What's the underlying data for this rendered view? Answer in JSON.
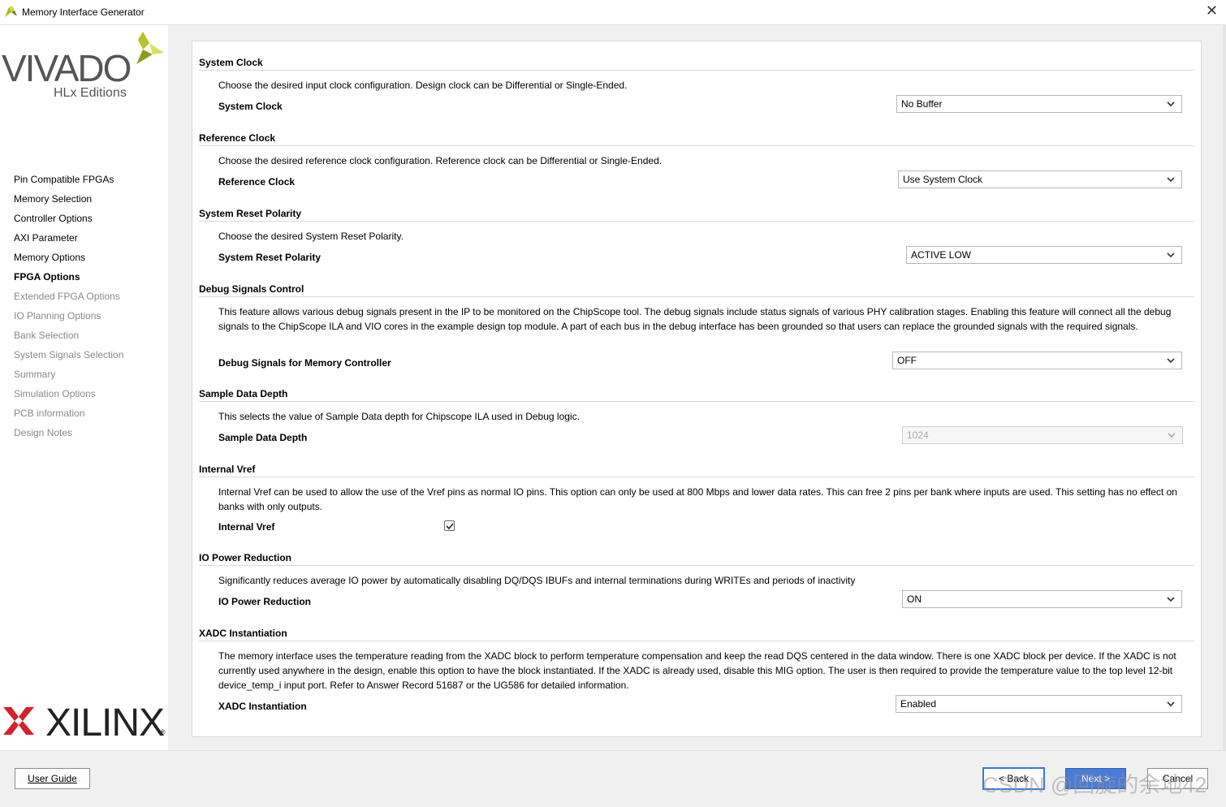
{
  "window": {
    "title": "Memory Interface Generator",
    "close_glyph": "✕"
  },
  "branding": {
    "vivado": "VIVADO",
    "hlx": "HLx Editions",
    "xilinx": "XILINX",
    "registered": "®"
  },
  "nav": [
    {
      "label": "Pin Compatible FPGAs",
      "state": "done"
    },
    {
      "label": "Memory Selection",
      "state": "done"
    },
    {
      "label": "Controller Options",
      "state": "done"
    },
    {
      "label": "AXI Parameter",
      "state": "done"
    },
    {
      "label": "Memory Options",
      "state": "done"
    },
    {
      "label": "FPGA Options",
      "state": "current"
    },
    {
      "label": "Extended FPGA Options",
      "state": "todo"
    },
    {
      "label": "IO Planning Options",
      "state": "todo"
    },
    {
      "label": "Bank Selection",
      "state": "todo"
    },
    {
      "label": "System Signals Selection",
      "state": "todo"
    },
    {
      "label": "Summary",
      "state": "todo"
    },
    {
      "label": "Simulation Options",
      "state": "todo"
    },
    {
      "label": "PCB information",
      "state": "todo"
    },
    {
      "label": "Design Notes",
      "state": "todo"
    }
  ],
  "sections": {
    "system_clock": {
      "title": "System Clock",
      "description": "Choose the desired input clock configuration. Design clock can be Differential or Single-Ended.",
      "label": "System Clock",
      "value": "No Buffer"
    },
    "reference_clock": {
      "title": "Reference Clock",
      "description": "Choose the desired reference clock configuration. Reference clock can be Differential or Single-Ended.",
      "label": "Reference Clock",
      "value": "Use System Clock"
    },
    "reset_polarity": {
      "title": "System Reset Polarity",
      "description": "Choose the desired System Reset Polarity.",
      "label": "System Reset Polarity",
      "value": "ACTIVE LOW"
    },
    "debug": {
      "title": "Debug Signals Control",
      "description": "This feature allows various debug signals present in the IP to be monitored on the ChipScope tool. The debug signals include status signals of various PHY calibration stages. Enabling this feature will connect all the debug signals to the ChipScope ILA and VIO cores in the example design top module. A part of each bus in the debug interface has been grounded so that users can replace the grounded signals with the required signals.",
      "label": "Debug Signals for Memory Controller",
      "value": "OFF"
    },
    "sample_depth": {
      "title": "Sample Data Depth",
      "description": "This selects the value of Sample Data depth for Chipscope ILA used in Debug logic.",
      "label": "Sample Data Depth",
      "value": "1024"
    },
    "internal_vref": {
      "title": "Internal Vref",
      "description": "Internal Vref can be used to allow the use of the Vref pins as normal IO pins. This option can only be used at 800 Mbps and lower data rates. This can free 2 pins per bank where inputs are used. This setting has no effect on banks with only outputs.",
      "label": "Internal Vref",
      "checked": true
    },
    "io_power": {
      "title": "IO Power Reduction",
      "description": "Significantly reduces average IO power by automatically disabling DQ/DQS IBUFs and internal terminations during WRITEs and periods of inactivity",
      "label": "IO Power Reduction",
      "value": "ON"
    },
    "xadc": {
      "title": "XADC Instantiation",
      "description": "The memory interface uses the temperature reading from the XADC block to perform temperature compensation and keep the read DQS centered in the data window. There is one XADC block per device. If the XADC is not currently used anywhere in the design, enable this option to have the block instantiated. If the XADC is already used, disable this MIG option. The user is then required to provide the temperature value to the top level 12-bit device_temp_i input port. Refer to Answer Record 51687 or the UG586 for detailed information.",
      "label": "XADC Instantiation",
      "value": "Enabled"
    }
  },
  "footer": {
    "user_guide": "User Guide",
    "back": "< Back",
    "next": "Next >",
    "cancel": "Cancel"
  },
  "watermark": "CSDN @回旋的余地42",
  "colors": {
    "accent": "#4a7bd6",
    "xilinx_red": "#d2232a",
    "vivado_yellow": "#b5c42a"
  }
}
